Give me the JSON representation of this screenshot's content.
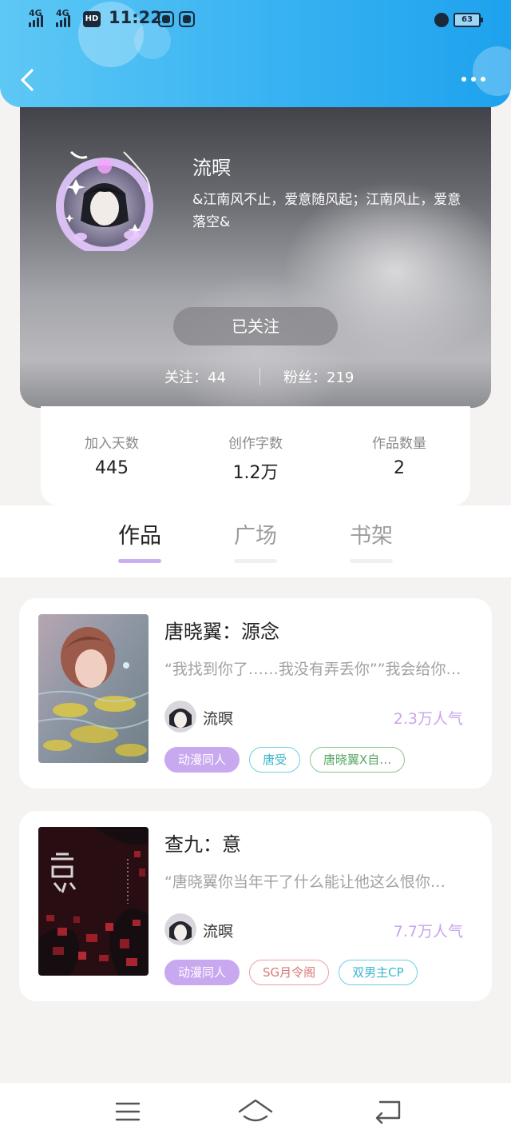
{
  "status_bar": {
    "network1": "4G",
    "network2": "4G",
    "hd": "HD",
    "time": "11:22",
    "battery": "63"
  },
  "profile": {
    "name": "流暝",
    "bio": "&江南风不止，爱意随风起；江南风止，爱意落空&",
    "follow_button": "已关注",
    "following": "关注：44",
    "fans": "粉丝：219"
  },
  "stats": [
    {
      "label": "加入天数",
      "value": "445"
    },
    {
      "label": "创作字数",
      "value": "1.2万"
    },
    {
      "label": "作品数量",
      "value": "2"
    }
  ],
  "tabs": [
    {
      "label": "作品",
      "active": true
    },
    {
      "label": "广场",
      "active": false
    },
    {
      "label": "书架",
      "active": false
    }
  ],
  "works": [
    {
      "title": "唐晓翼：源念",
      "excerpt": "“我找到你了……我没有弄丢你””我会给你…",
      "author": "流暝",
      "popularity": "2.3万人气",
      "tags": [
        "动漫同人",
        "唐受",
        "唐晓翼X自…"
      ]
    },
    {
      "title": "查九：意",
      "excerpt": "“唐晓翼你当年干了什么能让他这么恨你…",
      "author": "流暝",
      "popularity": "7.7万人气",
      "tags": [
        "动漫同人",
        "SG月令阁",
        "双男主CP"
      ]
    }
  ],
  "icons": {
    "back": "chevron-left-icon",
    "more": "more-dots-icon",
    "nav_menu": "menu-icon",
    "nav_home": "home-icon",
    "nav_back": "return-icon"
  },
  "colors": {
    "header_blue": "#3ab4f2",
    "accent_purple": "#c8a8ef",
    "popularity_purple": "#c7a6ec"
  }
}
